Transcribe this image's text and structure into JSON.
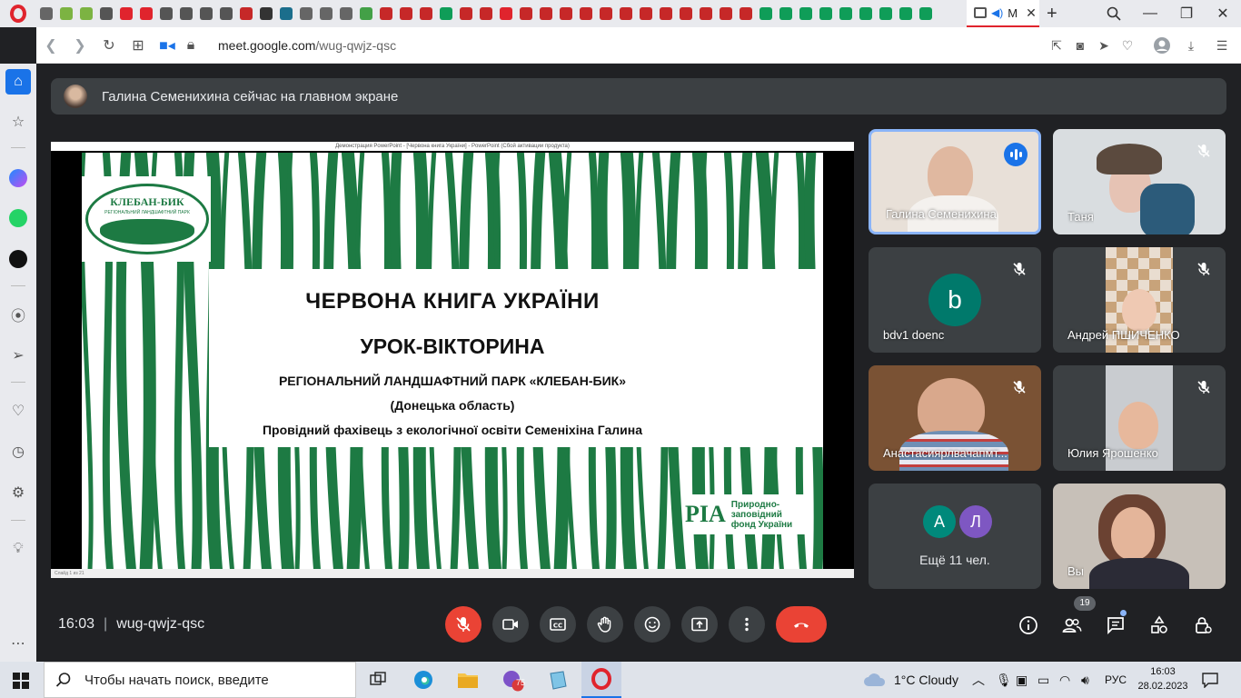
{
  "browser": {
    "active_tab_label": "M",
    "url_domain": "meet.google.com",
    "url_path": "/wug-qwjz-qsc"
  },
  "meet": {
    "presenter_banner": "Галина Семенихина сейчас на главном экране",
    "slide": {
      "ppt_window_title": "Демонстрация PowerPoint - [Червона книга України] - PowerPoint (Сбой активации продукта)",
      "logo_title": "КЛЕБАН-БИК",
      "logo_subtitle": "РЕГІОНАЛЬНИЙ ЛАНДШАФТНИЙ ПАРК",
      "title_line1": "ЧЕРВОНА КНИГА УКРАЇНИ",
      "title_line2": "УРОК-ВІКТОРИНА",
      "line3": "РЕГІОНАЛЬНИЙ ЛАНДШАФТНИЙ ПАРК «КЛЕБАН-БИК»",
      "line4": "(Донецька область)",
      "line5": "Провідний фахівець з екологічної освіти Семеніхіна Галина",
      "fund_line1": "Природно-",
      "fund_line2": "заповідний",
      "fund_line3": "фонд України",
      "status_text": "Слайд 1 из 21"
    },
    "participants": [
      {
        "name": "Галина Семенихина",
        "state": "speaking"
      },
      {
        "name": "Таня",
        "state": "muted"
      },
      {
        "name": "bdv1 doenc",
        "state": "muted",
        "avatar_letter": "b",
        "avatar_color": "#00796b"
      },
      {
        "name": "Андрей ПШИЧЕНКО",
        "state": "muted"
      },
      {
        "name": "Анастасиярлвачапмт...",
        "state": "muted"
      },
      {
        "name": "Юлия Ярошенко",
        "state": "muted"
      },
      {
        "more_label": "Ещё 11 чел.",
        "avatars": [
          "А",
          "Л"
        ],
        "avatar_colors": [
          "#00897b",
          "#7e57c2"
        ]
      },
      {
        "name": "Вы",
        "state": "self"
      }
    ],
    "time": "16:03",
    "meeting_code": "wug-qwjz-qsc",
    "participant_count": "19"
  },
  "taskbar": {
    "search_placeholder": "Чтобы начать поиск, введите",
    "weather": "1°C  Cloudy",
    "language": "РУС",
    "clock_time": "16:03",
    "clock_date": "28.02.2023",
    "badge_count": "75"
  },
  "colors": {
    "meet_bg": "#202124",
    "tile_bg": "#3c4043",
    "end_call": "#ea4335",
    "speaking_border": "#8ab4f8",
    "slide_green": "#1d7a43",
    "opera_red": "#e0242d"
  }
}
